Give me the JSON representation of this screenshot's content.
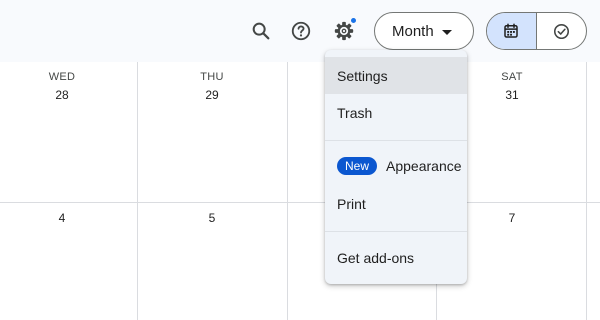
{
  "header": {
    "view_selector": {
      "selected": "Month"
    },
    "icons": [
      "search-icon",
      "help-icon",
      "settings-icon"
    ],
    "view_toggle": [
      "calendar-icon",
      "tasks-icon"
    ],
    "accent_color": "#1a73e8"
  },
  "calendar": {
    "week1": [
      {
        "dow": "WED",
        "day": "28"
      },
      {
        "dow": "THU",
        "day": "29"
      },
      {
        "dow": "",
        "day": ""
      },
      {
        "dow": "SAT",
        "day": "31"
      }
    ],
    "week2": [
      {
        "day": "4"
      },
      {
        "day": "5"
      },
      {
        "day": ""
      },
      {
        "day": "7"
      }
    ]
  },
  "settings_menu": {
    "items": [
      {
        "label": "Settings"
      },
      {
        "label": "Trash"
      },
      {
        "label": "Appearance",
        "badge": "New"
      },
      {
        "label": "Print"
      },
      {
        "label": "Get add-ons"
      }
    ]
  }
}
